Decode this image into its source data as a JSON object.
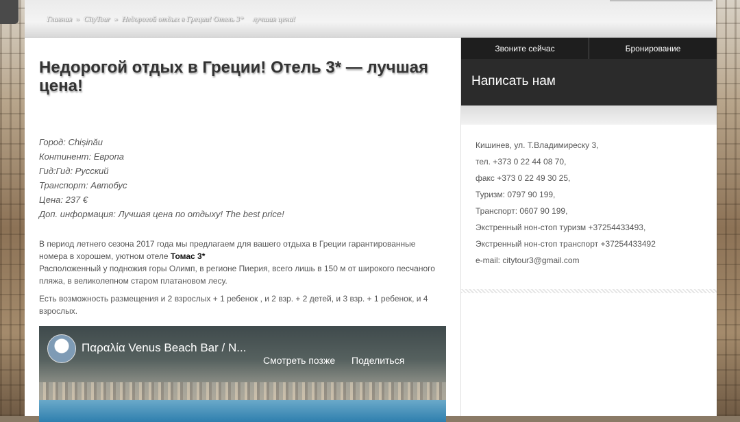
{
  "breadcrumb": {
    "home": "Главная",
    "sep": "»",
    "site": "CityTour",
    "current": "Недорогой отдых в Греции! Отель 3*",
    "current_tail": "лучшая цена!"
  },
  "article": {
    "title": "Недорогой отдых в Греции! Отель 3* — лучшая цена!",
    "info": [
      "Город: Chișinău",
      "Континент: Европа",
      "Гид:Гид: Русский",
      "Транспорт: Автобус",
      "Цена: 237 €",
      "Доп. информация: Лучшая цена по отдыху! The best price!"
    ],
    "para1": "В период летнего сезона 2017 года мы предлагаем для вашего отдыха в Греции гарантированные номера в хорошем, уютном отеле",
    "hotel": "Томас 3*",
    "para2": "Расположенный у подножия горы Олимп, в регионе Пиерия, всего лишь в 150 м от широкого песчаного пляжа, в великолепном старом платановом лесу.",
    "para3": "Есть возможность размещения и 2 взрослых + 1 ребенок , и 2 взр. + 2 детей, и 3 взр. + 1 ребенок, и 4 взрослых."
  },
  "video": {
    "title": "Παραλία Venus Beach Bar / N...",
    "watch_later": "Смотреть позже",
    "share": "Поделиться"
  },
  "sidebar": {
    "tabs": [
      "Звоните сейчас",
      "Бронирование"
    ],
    "write_us": "Написать нам",
    "contacts": [
      "Кишинев, ул. Т.Владимиреску 3,",
      "тел. +373 0 22 44 08 70,",
      "факс +373 0 22 49 30 25,",
      "Туризм: 0797 90 199,",
      "Транспорт: 0607 90 199,",
      "Экстренный нон-стоп туризм +37254433493,",
      "Экстренный нон-стоп транспорт +37254433492",
      "e-mail: citytour3@gmail.com"
    ]
  }
}
